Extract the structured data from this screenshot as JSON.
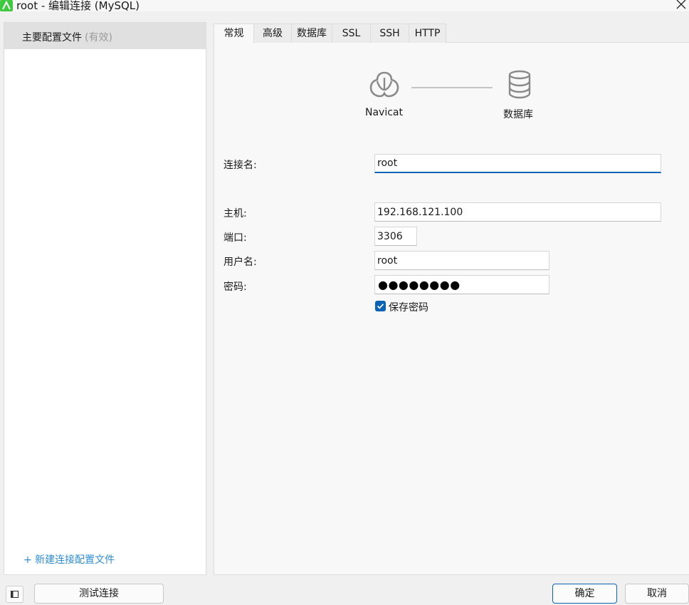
{
  "window": {
    "title": "root - 编辑连接 (MySQL)",
    "app_icon": "navicat-icon",
    "close_icon": "close-icon"
  },
  "sidebar": {
    "profile_label": "主要配置文件",
    "profile_status": "(有效)",
    "new_profile": "+ 新建连接配置文件"
  },
  "tabs": [
    {
      "label": "常规",
      "active": true
    },
    {
      "label": "高级"
    },
    {
      "label": "数据库"
    },
    {
      "label": "SSL"
    },
    {
      "label": "SSH"
    },
    {
      "label": "HTTP"
    }
  ],
  "diagram": {
    "client_label": "Navicat",
    "server_label": "数据库"
  },
  "form": {
    "connection_name_label": "连接名:",
    "connection_name": "root",
    "host_label": "主机:",
    "host": "192.168.121.100",
    "port_label": "端口:",
    "port": "3306",
    "username_label": "用户名:",
    "username": "root",
    "password_label": "密码:",
    "password_mask": "●●●●●●●●",
    "save_password_label": "保存密码",
    "save_password": true
  },
  "footer": {
    "test_button": "测试连接",
    "ok_button": "确定",
    "cancel_button": "取消"
  },
  "colors": {
    "accent": "#0a64b5",
    "link": "#2f8fd4",
    "app_icon_green": "#3ec93e"
  }
}
